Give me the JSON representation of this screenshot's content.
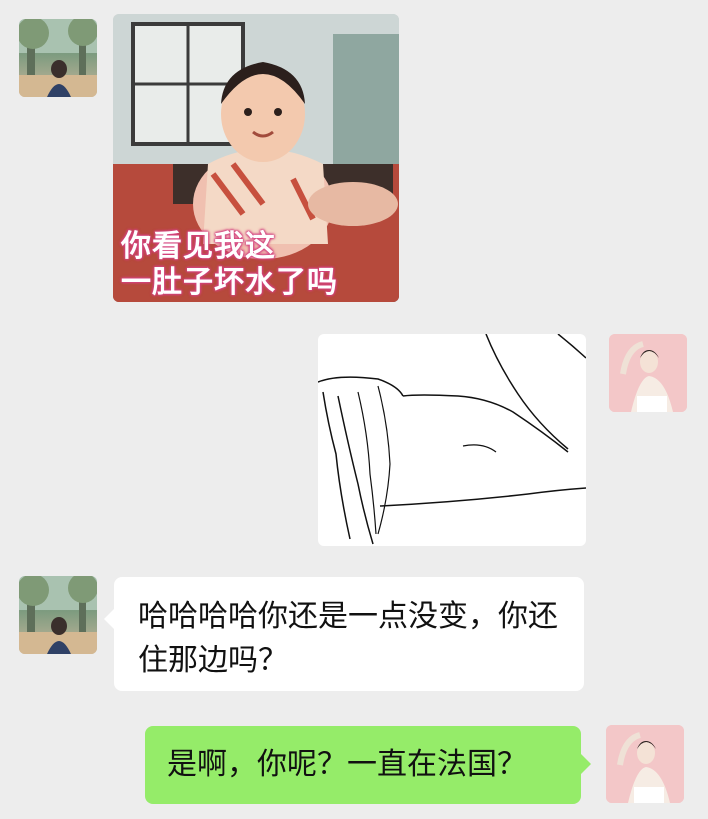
{
  "chat": {
    "sticker_baby_caption_line1": "你看见我这",
    "sticker_baby_caption_line2": "一肚子坏水了吗",
    "friend_message": "哈哈哈哈你还是一点没变，你还住那边吗？",
    "my_message": "是啊，你呢？一直在法国？"
  },
  "colors": {
    "background": "#ededed",
    "incoming_bubble": "#ffffff",
    "outgoing_bubble": "#95ec69"
  },
  "icons": {
    "friend_avatar": "park-photo-avatar",
    "my_avatar": "illustrated-lady-avatar"
  }
}
